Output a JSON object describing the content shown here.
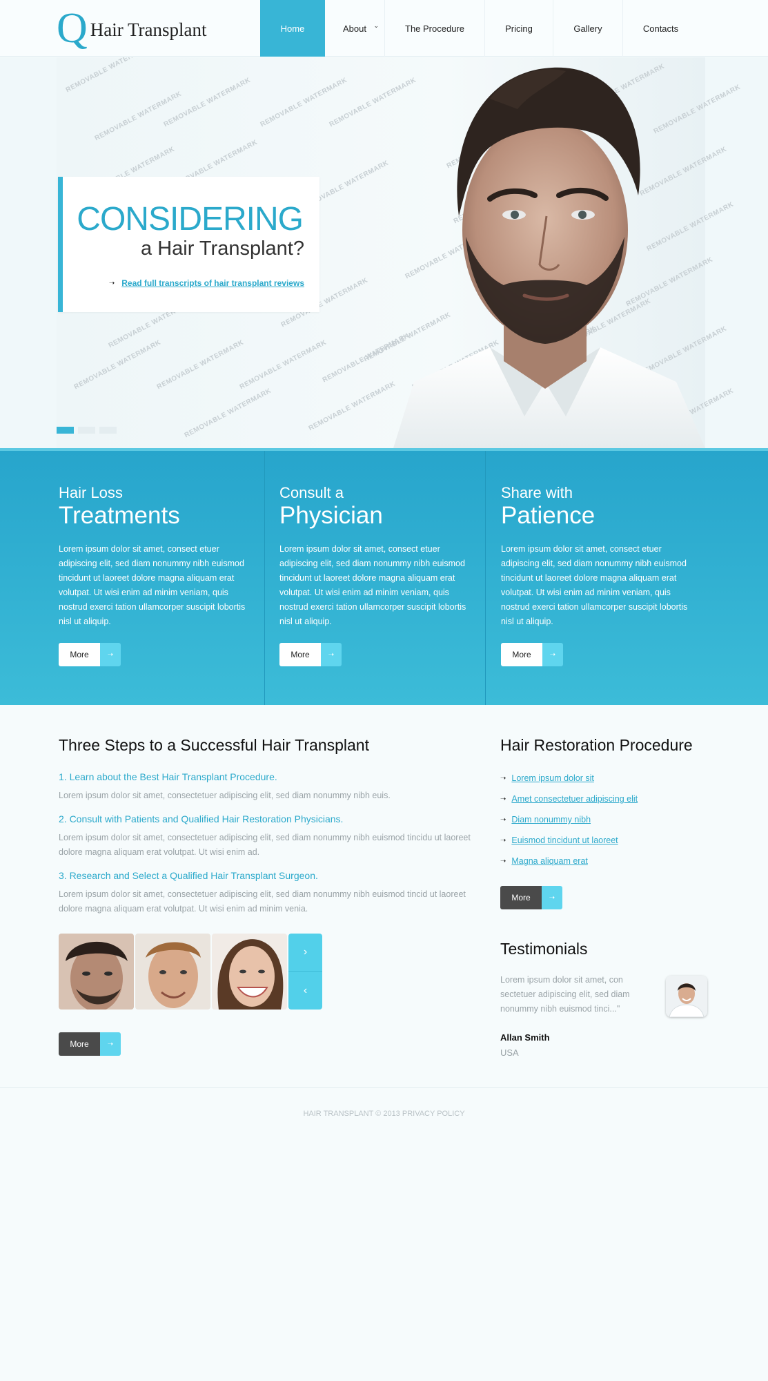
{
  "brand": {
    "logo_mark": "Q",
    "name": "Hair Transplant",
    "accent_color": "#38b5d6"
  },
  "nav": {
    "items": [
      {
        "label": "Home",
        "active": true
      },
      {
        "label": "About",
        "has_dropdown": true
      },
      {
        "label": "The Procedure"
      },
      {
        "label": "Pricing"
      },
      {
        "label": "Gallery"
      },
      {
        "label": "Contacts"
      }
    ]
  },
  "hero": {
    "headline": "CONSIDERING",
    "subheadline": "a Hair Transplant?",
    "link_text": "Read full transcripts of hair transplant reviews",
    "watermark_text": "REMOVABLE WATERMARK",
    "slides_total": 3,
    "slide_active": 1
  },
  "features": [
    {
      "small_title": "Hair Loss",
      "big_title": "Treatments",
      "text": "Lorem ipsum dolor sit amet, consect etuer adipiscing elit, sed diam nonummy nibh euismod tincidunt ut laoreet dolore magna aliquam erat volutpat. Ut wisi enim ad minim veniam, quis nostrud exerci tation ullamcorper suscipit lobortis nisl ut aliquip.",
      "button": "More"
    },
    {
      "small_title": "Consult a",
      "big_title": "Physician",
      "text": "Lorem ipsum dolor sit amet, consect etuer adipiscing elit, sed diam nonummy nibh euismod tincidunt ut laoreet dolore magna aliquam erat volutpat. Ut wisi enim ad minim veniam, quis nostrud exerci tation ullamcorper suscipit lobortis nisl ut aliquip.",
      "button": "More"
    },
    {
      "small_title": "Share with",
      "big_title": "Patience",
      "text": "Lorem ipsum dolor sit amet, consect etuer adipiscing elit, sed diam nonummy nibh euismod tincidunt ut laoreet dolore magna aliquam erat volutpat. Ut wisi enim ad minim veniam, quis nostrud exerci tation ullamcorper suscipit lobortis nisl ut aliquip.",
      "button": "More"
    }
  ],
  "steps": {
    "title": "Three Steps to a Successful Hair Transplant",
    "items": [
      {
        "title": "1. Learn about the Best Hair Transplant Procedure.",
        "text": "Lorem ipsum dolor sit amet, consectetuer adipiscing elit, sed diam nonummy nibh euis."
      },
      {
        "title": "2. Consult with Patients and Qualified Hair Restoration Physicians.",
        "text": "Lorem ipsum dolor sit amet, consectetuer adipiscing elit, sed diam nonummy nibh euismod tincidu ut laoreet dolore magna aliquam erat volutpat. Ut wisi enim ad."
      },
      {
        "title": "3. Research and Select a Qualified Hair Transplant Surgeon.",
        "text": "Lorem ipsum dolor sit amet, consectetuer adipiscing elit, sed diam nonummy nibh euismod tincid ut laoreet dolore magna aliquam erat volutpat. Ut wisi enim ad minim venia."
      }
    ],
    "button": "More"
  },
  "procedure": {
    "title": "Hair Restoration Procedure",
    "links": [
      "Lorem ipsum dolor sit",
      "Amet consectetuer adipiscing elit",
      "Diam nonummy nibh",
      "Euismod tincidunt ut laoreet",
      "Magna aliquam erat"
    ],
    "button": "More"
  },
  "testimonials": {
    "title": "Testimonials",
    "quote": "Lorem ipsum dolor sit amet, con sectetuer adipiscing elit, sed diam nonummy nibh euismod tinci...\"",
    "name": "Allan Smith",
    "location": "USA"
  },
  "footer": {
    "text": "HAIR TRANSPLANT © 2013 PRIVACY POLICY"
  }
}
